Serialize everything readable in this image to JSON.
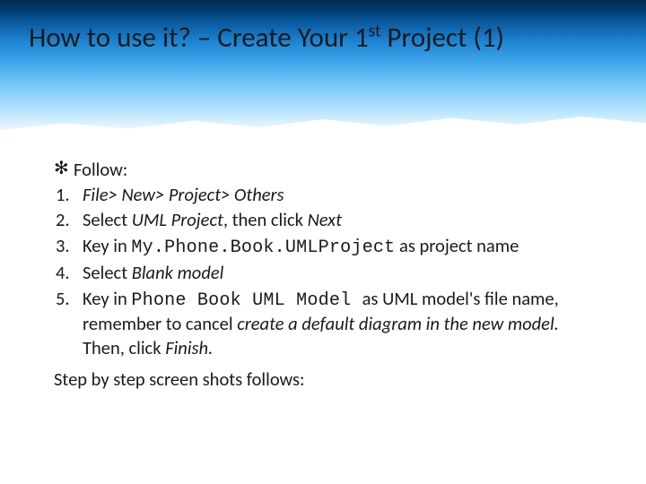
{
  "title": {
    "pre": "How to use it? – Create Your 1",
    "sup": "st",
    "post": " Project (1)"
  },
  "follow": {
    "bullet": "✻",
    "label": "Follow:"
  },
  "steps": [
    {
      "n": "1.",
      "parts": [
        {
          "t": "File> New> Project> Others",
          "cls": "it"
        }
      ]
    },
    {
      "n": "2.",
      "parts": [
        {
          "t": "Select ",
          "cls": ""
        },
        {
          "t": "UML Project",
          "cls": "it"
        },
        {
          "t": ", then click ",
          "cls": ""
        },
        {
          "t": "Next",
          "cls": "it"
        }
      ]
    },
    {
      "n": "3.",
      "parts": [
        {
          "t": "Key in ",
          "cls": ""
        },
        {
          "t": "My.Phone.Book.UMLProject",
          "cls": "mono"
        },
        {
          "t": " as project name",
          "cls": ""
        }
      ]
    },
    {
      "n": "4.",
      "parts": [
        {
          "t": "Select ",
          "cls": ""
        },
        {
          "t": "Blank model",
          "cls": "it"
        }
      ]
    },
    {
      "n": "5.",
      "parts": [
        {
          "t": "Key in ",
          "cls": ""
        },
        {
          "t": "Phone Book UML Model ",
          "cls": "mono"
        },
        {
          "t": "as UML model's file name, remember to cancel ",
          "cls": ""
        },
        {
          "t": "create a default diagram in the new model. ",
          "cls": "it"
        },
        {
          "t": "Then, click ",
          "cls": ""
        },
        {
          "t": "Finish.",
          "cls": "it"
        }
      ]
    }
  ],
  "footer": "Step by step screen shots follows:"
}
